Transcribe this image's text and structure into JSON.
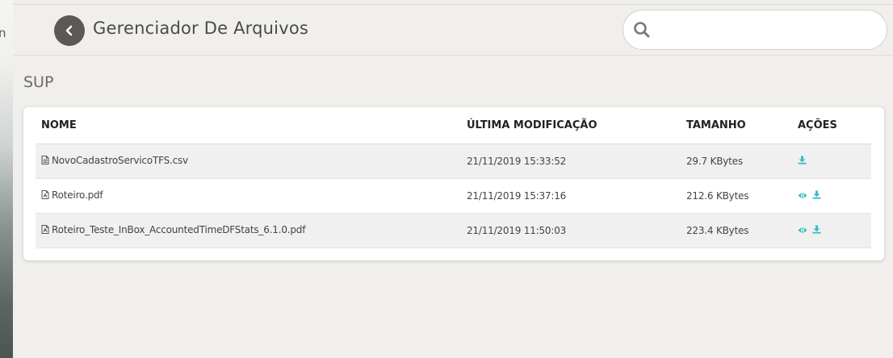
{
  "header": {
    "title": "Gerenciador De Arquivos",
    "search_placeholder": ""
  },
  "folder": {
    "name": "SUP"
  },
  "table": {
    "columns": [
      "NOME",
      "ÚLTIMA MODIFICAÇÃO",
      "TAMANHO",
      "AÇÕES"
    ],
    "rows": [
      {
        "icon": "file-text-icon",
        "name": "NovoCadastroServicoTFS.csv",
        "modified": "21/11/2019 15:33:52",
        "size": "29.7 KBytes",
        "actions": [
          "download-icon"
        ]
      },
      {
        "icon": "file-pdf-icon",
        "name": "Roteiro.pdf",
        "modified": "21/11/2019 15:37:16",
        "size": "212.6 KBytes",
        "actions": [
          "eye-icon",
          "download-icon"
        ]
      },
      {
        "icon": "file-pdf-icon",
        "name": "Roteiro_Teste_InBox_AccountedTimeDFStats_6.1.0.pdf",
        "modified": "21/11/2019 11:50:03",
        "size": "223.4 KBytes",
        "actions": [
          "eye-icon",
          "download-icon"
        ]
      }
    ]
  },
  "sidebar": {
    "partial_text": "n"
  },
  "colors": {
    "accent": "#3bbcc4",
    "back_button": "#5b5856",
    "background": "#f1efec"
  }
}
